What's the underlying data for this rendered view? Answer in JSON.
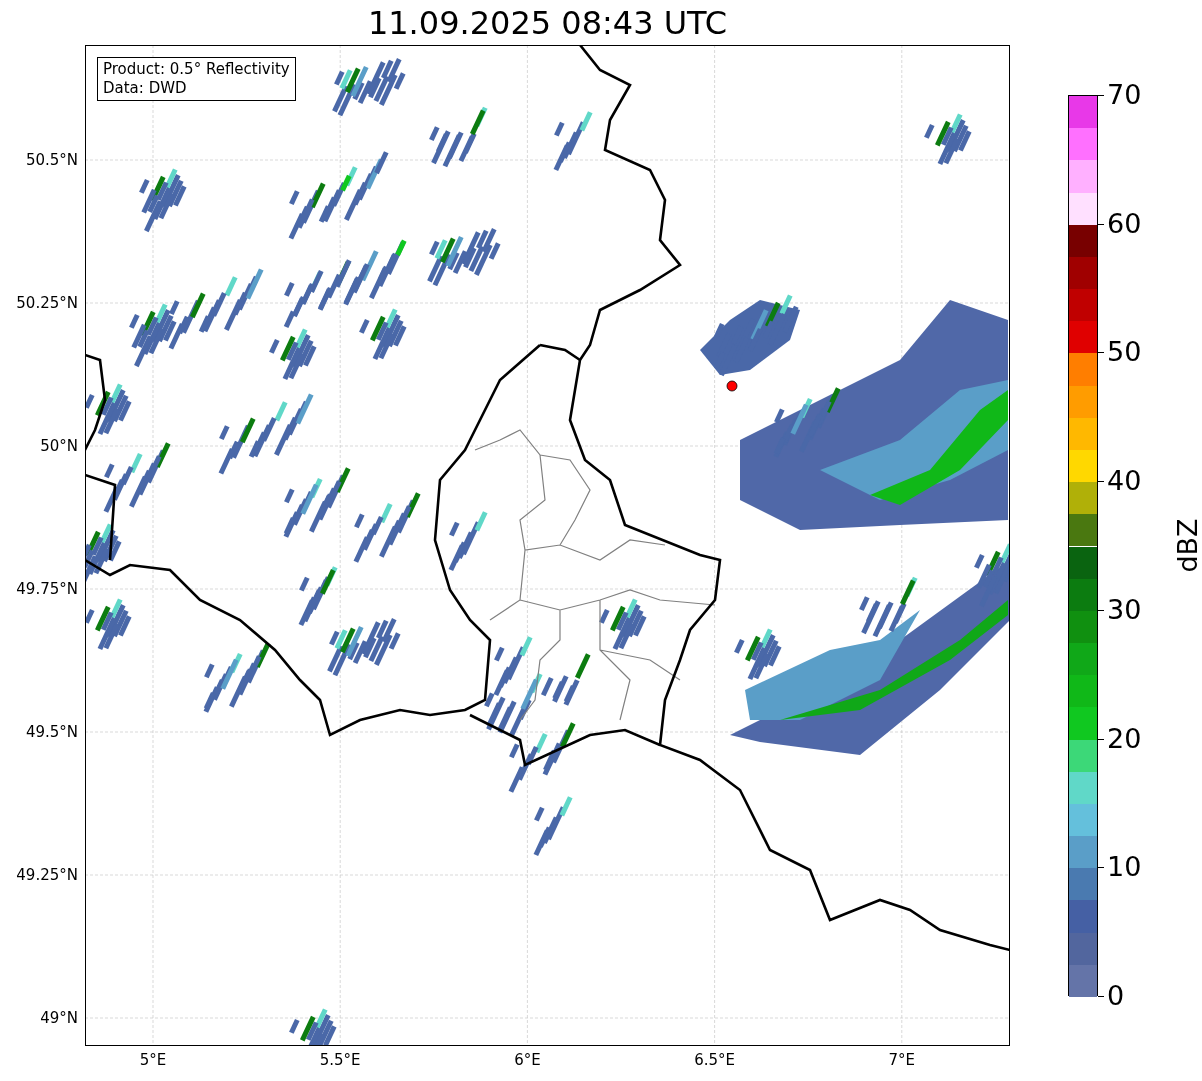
{
  "title": "11.09.2025 08:43 UTC",
  "info_box": {
    "lines": [
      "Product: 0.5° Reflectivity",
      "Data: DWD"
    ]
  },
  "y_ticks": [
    "50.5°N",
    "50.25°N",
    "50°N",
    "49.75°N",
    "49.5°N",
    "49.25°N",
    "49°N"
  ],
  "x_ticks": [
    "5°E",
    "5.5°E",
    "6°E",
    "6.5°E",
    "7°E"
  ],
  "colorbar": {
    "label": "dBZ",
    "ticks": [
      "70",
      "60",
      "50",
      "40",
      "30",
      "20",
      "10",
      "0"
    ],
    "segments": [
      {
        "color": "#e838e8"
      },
      {
        "color": "#ff70ff"
      },
      {
        "color": "#ffb0ff"
      },
      {
        "color": "#ffe0ff"
      },
      {
        "color": "#780000"
      },
      {
        "color": "#a00000"
      },
      {
        "color": "#c00000"
      },
      {
        "color": "#e00000"
      },
      {
        "color": "#ff7e00"
      },
      {
        "color": "#ff9c00"
      },
      {
        "color": "#ffb800"
      },
      {
        "color": "#ffd800"
      },
      {
        "color": "#b0b008"
      },
      {
        "color": "#4a7810"
      },
      {
        "color": "#0a6410"
      },
      {
        "color": "#0c7c10"
      },
      {
        "color": "#109010"
      },
      {
        "color": "#10a818"
      },
      {
        "color": "#10b818"
      },
      {
        "color": "#10c820"
      },
      {
        "color": "#3cd878"
      },
      {
        "color": "#60d8c8"
      },
      {
        "color": "#64c0dc"
      },
      {
        "color": "#5a9ec8"
      },
      {
        "color": "#4a7ab0"
      },
      {
        "color": "#4560a4"
      },
      {
        "color": "#52669e"
      },
      {
        "color": "#6474a8"
      }
    ]
  }
}
